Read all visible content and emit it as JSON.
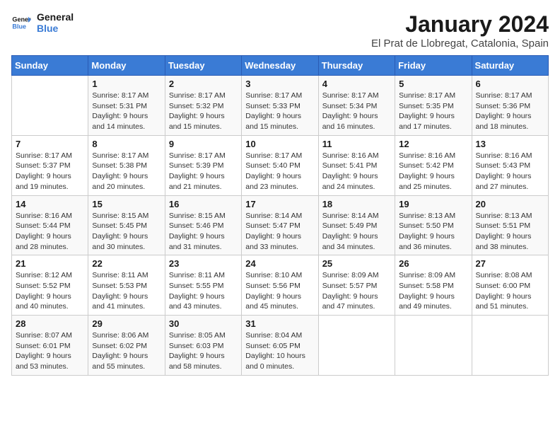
{
  "logo": {
    "text_general": "General",
    "text_blue": "Blue"
  },
  "title": "January 2024",
  "subtitle": "El Prat de Llobregat, Catalonia, Spain",
  "weekdays": [
    "Sunday",
    "Monday",
    "Tuesday",
    "Wednesday",
    "Thursday",
    "Friday",
    "Saturday"
  ],
  "weeks": [
    [
      {
        "day": "",
        "sunrise": "",
        "sunset": "",
        "daylight": ""
      },
      {
        "day": "1",
        "sunrise": "Sunrise: 8:17 AM",
        "sunset": "Sunset: 5:31 PM",
        "daylight": "Daylight: 9 hours and 14 minutes."
      },
      {
        "day": "2",
        "sunrise": "Sunrise: 8:17 AM",
        "sunset": "Sunset: 5:32 PM",
        "daylight": "Daylight: 9 hours and 15 minutes."
      },
      {
        "day": "3",
        "sunrise": "Sunrise: 8:17 AM",
        "sunset": "Sunset: 5:33 PM",
        "daylight": "Daylight: 9 hours and 15 minutes."
      },
      {
        "day": "4",
        "sunrise": "Sunrise: 8:17 AM",
        "sunset": "Sunset: 5:34 PM",
        "daylight": "Daylight: 9 hours and 16 minutes."
      },
      {
        "day": "5",
        "sunrise": "Sunrise: 8:17 AM",
        "sunset": "Sunset: 5:35 PM",
        "daylight": "Daylight: 9 hours and 17 minutes."
      },
      {
        "day": "6",
        "sunrise": "Sunrise: 8:17 AM",
        "sunset": "Sunset: 5:36 PM",
        "daylight": "Daylight: 9 hours and 18 minutes."
      }
    ],
    [
      {
        "day": "7",
        "sunrise": "Sunrise: 8:17 AM",
        "sunset": "Sunset: 5:37 PM",
        "daylight": "Daylight: 9 hours and 19 minutes."
      },
      {
        "day": "8",
        "sunrise": "Sunrise: 8:17 AM",
        "sunset": "Sunset: 5:38 PM",
        "daylight": "Daylight: 9 hours and 20 minutes."
      },
      {
        "day": "9",
        "sunrise": "Sunrise: 8:17 AM",
        "sunset": "Sunset: 5:39 PM",
        "daylight": "Daylight: 9 hours and 21 minutes."
      },
      {
        "day": "10",
        "sunrise": "Sunrise: 8:17 AM",
        "sunset": "Sunset: 5:40 PM",
        "daylight": "Daylight: 9 hours and 23 minutes."
      },
      {
        "day": "11",
        "sunrise": "Sunrise: 8:16 AM",
        "sunset": "Sunset: 5:41 PM",
        "daylight": "Daylight: 9 hours and 24 minutes."
      },
      {
        "day": "12",
        "sunrise": "Sunrise: 8:16 AM",
        "sunset": "Sunset: 5:42 PM",
        "daylight": "Daylight: 9 hours and 25 minutes."
      },
      {
        "day": "13",
        "sunrise": "Sunrise: 8:16 AM",
        "sunset": "Sunset: 5:43 PM",
        "daylight": "Daylight: 9 hours and 27 minutes."
      }
    ],
    [
      {
        "day": "14",
        "sunrise": "Sunrise: 8:16 AM",
        "sunset": "Sunset: 5:44 PM",
        "daylight": "Daylight: 9 hours and 28 minutes."
      },
      {
        "day": "15",
        "sunrise": "Sunrise: 8:15 AM",
        "sunset": "Sunset: 5:45 PM",
        "daylight": "Daylight: 9 hours and 30 minutes."
      },
      {
        "day": "16",
        "sunrise": "Sunrise: 8:15 AM",
        "sunset": "Sunset: 5:46 PM",
        "daylight": "Daylight: 9 hours and 31 minutes."
      },
      {
        "day": "17",
        "sunrise": "Sunrise: 8:14 AM",
        "sunset": "Sunset: 5:47 PM",
        "daylight": "Daylight: 9 hours and 33 minutes."
      },
      {
        "day": "18",
        "sunrise": "Sunrise: 8:14 AM",
        "sunset": "Sunset: 5:49 PM",
        "daylight": "Daylight: 9 hours and 34 minutes."
      },
      {
        "day": "19",
        "sunrise": "Sunrise: 8:13 AM",
        "sunset": "Sunset: 5:50 PM",
        "daylight": "Daylight: 9 hours and 36 minutes."
      },
      {
        "day": "20",
        "sunrise": "Sunrise: 8:13 AM",
        "sunset": "Sunset: 5:51 PM",
        "daylight": "Daylight: 9 hours and 38 minutes."
      }
    ],
    [
      {
        "day": "21",
        "sunrise": "Sunrise: 8:12 AM",
        "sunset": "Sunset: 5:52 PM",
        "daylight": "Daylight: 9 hours and 40 minutes."
      },
      {
        "day": "22",
        "sunrise": "Sunrise: 8:11 AM",
        "sunset": "Sunset: 5:53 PM",
        "daylight": "Daylight: 9 hours and 41 minutes."
      },
      {
        "day": "23",
        "sunrise": "Sunrise: 8:11 AM",
        "sunset": "Sunset: 5:55 PM",
        "daylight": "Daylight: 9 hours and 43 minutes."
      },
      {
        "day": "24",
        "sunrise": "Sunrise: 8:10 AM",
        "sunset": "Sunset: 5:56 PM",
        "daylight": "Daylight: 9 hours and 45 minutes."
      },
      {
        "day": "25",
        "sunrise": "Sunrise: 8:09 AM",
        "sunset": "Sunset: 5:57 PM",
        "daylight": "Daylight: 9 hours and 47 minutes."
      },
      {
        "day": "26",
        "sunrise": "Sunrise: 8:09 AM",
        "sunset": "Sunset: 5:58 PM",
        "daylight": "Daylight: 9 hours and 49 minutes."
      },
      {
        "day": "27",
        "sunrise": "Sunrise: 8:08 AM",
        "sunset": "Sunset: 6:00 PM",
        "daylight": "Daylight: 9 hours and 51 minutes."
      }
    ],
    [
      {
        "day": "28",
        "sunrise": "Sunrise: 8:07 AM",
        "sunset": "Sunset: 6:01 PM",
        "daylight": "Daylight: 9 hours and 53 minutes."
      },
      {
        "day": "29",
        "sunrise": "Sunrise: 8:06 AM",
        "sunset": "Sunset: 6:02 PM",
        "daylight": "Daylight: 9 hours and 55 minutes."
      },
      {
        "day": "30",
        "sunrise": "Sunrise: 8:05 AM",
        "sunset": "Sunset: 6:03 PM",
        "daylight": "Daylight: 9 hours and 58 minutes."
      },
      {
        "day": "31",
        "sunrise": "Sunrise: 8:04 AM",
        "sunset": "Sunset: 6:05 PM",
        "daylight": "Daylight: 10 hours and 0 minutes."
      },
      {
        "day": "",
        "sunrise": "",
        "sunset": "",
        "daylight": ""
      },
      {
        "day": "",
        "sunrise": "",
        "sunset": "",
        "daylight": ""
      },
      {
        "day": "",
        "sunrise": "",
        "sunset": "",
        "daylight": ""
      }
    ]
  ]
}
